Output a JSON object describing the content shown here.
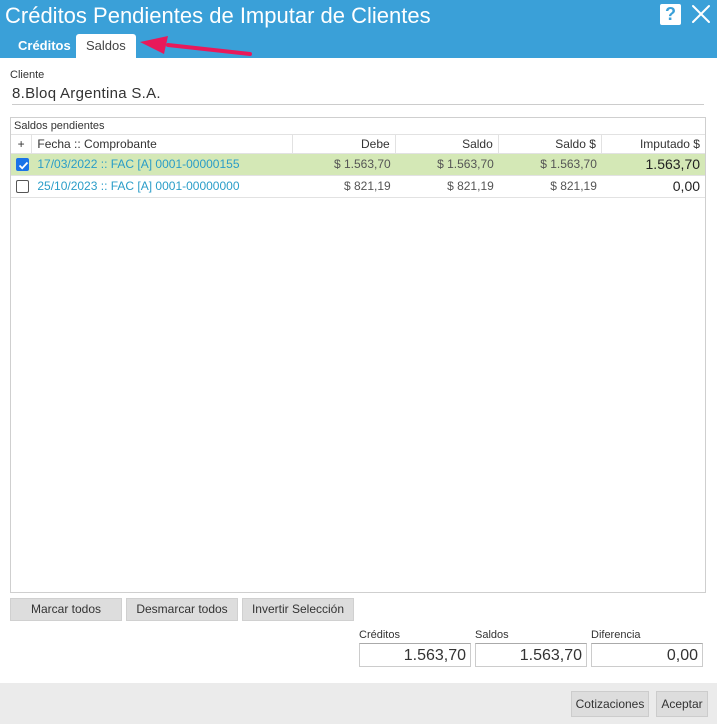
{
  "window": {
    "title": "Créditos Pendientes de Imputar de Clientes",
    "help_label": "?"
  },
  "tabs": [
    {
      "label": "Créditos",
      "active": false
    },
    {
      "label": "Saldos",
      "active": true
    }
  ],
  "cliente": {
    "label": "Cliente",
    "value": "8.Bloq Argentina S.A."
  },
  "panel": {
    "title": "Saldos pendientes"
  },
  "grid": {
    "columns": {
      "plus": "+",
      "fecha": "Fecha :: Comprobante",
      "debe": "Debe",
      "saldo": "Saldo",
      "saldo_usd": "Saldo $",
      "imputado": "Imputado $"
    },
    "rows": [
      {
        "checked": true,
        "comprobante": "17/03/2022 :: FAC [A] 0001-00000155",
        "debe": "$ 1.563,70",
        "saldo": "$ 1.563,70",
        "saldo_usd": "$ 1.563,70",
        "imputado": "1.563,70"
      },
      {
        "checked": false,
        "comprobante": "25/10/2023 :: FAC [A] 0001-00000000",
        "debe": "$ 821,19",
        "saldo": "$ 821,19",
        "saldo_usd": "$ 821,19",
        "imputado": "0,00"
      }
    ]
  },
  "actions": {
    "marcar": "Marcar todos",
    "desmarcar": "Desmarcar todos",
    "invertir": "Invertir Selección"
  },
  "totals": {
    "creditos_label": "Créditos",
    "creditos_value": "1.563,70",
    "saldos_label": "Saldos",
    "saldos_value": "1.563,70",
    "diferencia_label": "Diferencia",
    "diferencia_value": "0,00"
  },
  "footer": {
    "cotizaciones": "Cotizaciones",
    "aceptar": "Aceptar"
  },
  "colors": {
    "header": "#3aa0d8",
    "selected_row": "#d4e8b6",
    "link": "#2a9dc8",
    "arrow": "#e8195a"
  }
}
